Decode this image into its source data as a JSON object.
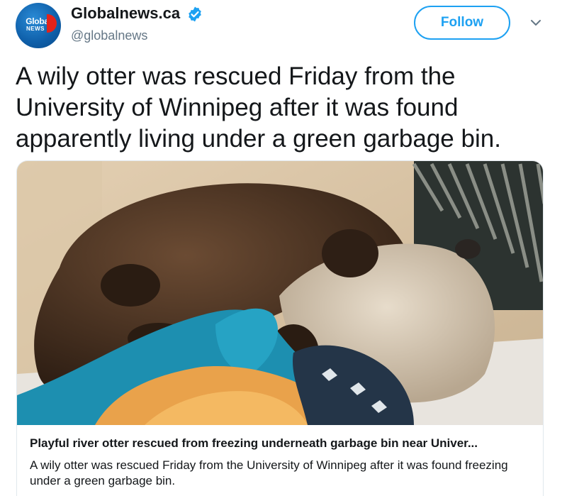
{
  "account": {
    "avatar_text": "Global",
    "avatar_subtext": "NEWS",
    "display_name": "Globalnews.ca",
    "handle": "@globalnews",
    "verified": true
  },
  "actions": {
    "follow_label": "Follow",
    "more_icon": "chevron-down-icon"
  },
  "tweet": {
    "text": "A wily otter was rescued Friday from the University of Winnipeg after it was found apparently living under a green garbage bin."
  },
  "card": {
    "image_icon": "otter-photo",
    "title": "Playful river otter rescued from freezing underneath garbage bin near Univer...",
    "description": "A wily otter was rescued Friday from the University of Winnipeg after it was found freezing under a green garbage bin."
  },
  "colors": {
    "accent": "#1da1f2",
    "text": "#14171a",
    "secondary_text": "#657786",
    "brand_blue": "#0e5ea8",
    "brand_red": "#e2231a"
  }
}
